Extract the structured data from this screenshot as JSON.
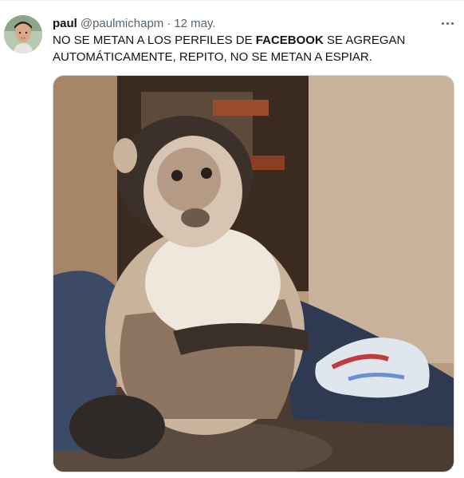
{
  "tweet": {
    "author_name": "paul",
    "author_handle": "@paulmichapm",
    "separator": "·",
    "date": "12 may.",
    "text_before": "NO SE METAN A LOS PERFILES DE ",
    "text_bold": "FACEBOOK",
    "text_after": " SE AGREGAN AUTOMÁTICAMENTE, REPITO, NO SE METAN A ESPIAR.",
    "more_icon": "more-horizontal-icon",
    "media_subject": "monkey-photo"
  },
  "colors": {
    "text_primary": "#0f1419",
    "text_secondary": "#536471",
    "border": "#cfd9de"
  }
}
